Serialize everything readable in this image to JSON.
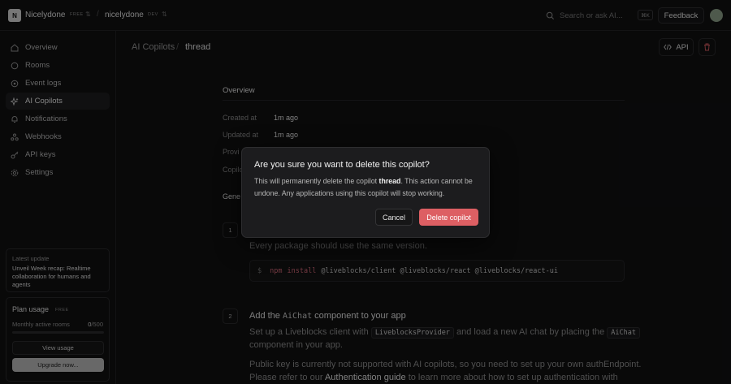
{
  "topbar": {
    "org_initial": "N",
    "org_name": "Nicelydone",
    "org_badge": "FREE",
    "project_name": "nicelydone",
    "project_badge": "DEV",
    "search_placeholder": "Search or ask AI...",
    "search_shortcut": "⌘K",
    "feedback_label": "Feedback"
  },
  "sidebar": {
    "items": [
      {
        "label": "Overview",
        "icon": "home-icon"
      },
      {
        "label": "Rooms",
        "icon": "circle-icon"
      },
      {
        "label": "Event logs",
        "icon": "target-icon"
      },
      {
        "label": "AI Copilots",
        "icon": "sparkle-icon",
        "active": true
      },
      {
        "label": "Notifications",
        "icon": "bell-icon"
      },
      {
        "label": "Webhooks",
        "icon": "webhook-icon"
      },
      {
        "label": "API keys",
        "icon": "key-icon"
      },
      {
        "label": "Settings",
        "icon": "gear-icon"
      }
    ],
    "update": {
      "kicker": "Latest update",
      "text": "Unveil Week recap: Realtime collaboration for humans and agents"
    },
    "usage": {
      "title": "Plan usage",
      "badge": "FREE",
      "metric_label": "Monthly active rooms",
      "used": "0",
      "limit": "/500",
      "fraction": 0,
      "view_label": "View usage",
      "upgrade_label": "Upgrade now..."
    }
  },
  "header": {
    "breadcrumb_parent": "AI Copilots",
    "breadcrumb_sep": "/",
    "breadcrumb_current": "thread",
    "api_label": "API"
  },
  "overview": {
    "title": "Overview",
    "rows": [
      {
        "label": "Created at",
        "value": "1m ago"
      },
      {
        "label": "Updated at",
        "value": "1m ago"
      },
      {
        "label": "Provi",
        "value": ""
      },
      {
        "label": "Copilo",
        "value": ""
      }
    ],
    "get_started": "Gene"
  },
  "steps": {
    "step1": {
      "num": "1",
      "text": "Every package should use the same version.",
      "code_prompt": "$",
      "code_cmd": "npm",
      "code_sub": "install",
      "code_args": "@liveblocks/client @liveblocks/react @liveblocks/react-ui"
    },
    "step2": {
      "num": "2",
      "title_pre": "Add the ",
      "title_code": "AiChat",
      "title_post": " component to your app",
      "line1_pre": "Set up a Liveblocks client with ",
      "line1_code1": "LiveblocksProvider",
      "line1_mid": " and load a new AI chat by placing the ",
      "line1_code2": "AiChat",
      "line2": "component in your app.",
      "line3": "Public key is currently not supported with AI copilots, so you need to set up your own authEndpoint.",
      "line4_pre": "Please refer to our ",
      "line4_link": "Authentication guide",
      "line4_post": " to learn more about how to set up authentication with"
    }
  },
  "dialog": {
    "title": "Are you sure you want to delete this copilot?",
    "body_pre": "This will permanently delete the copilot ",
    "body_name": "thread",
    "body_post": ". This action cannot be undone. Any applications using this copilot will stop working.",
    "cancel_label": "Cancel",
    "delete_label": "Delete copilot",
    "delete_color": "#dd5f63"
  }
}
